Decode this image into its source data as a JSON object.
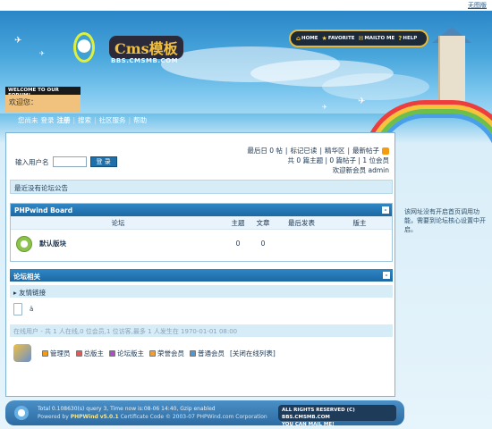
{
  "top_strip": {
    "link": "无图版"
  },
  "header": {
    "logo_text": "Cms模板",
    "logo_sub": "BBS.CMSMB.COM",
    "nav": [
      {
        "label": "HOME",
        "icon": "home-icon"
      },
      {
        "label": "FAVORITE",
        "icon": "star-icon"
      },
      {
        "label": "MAILTO ME",
        "icon": "mail-icon"
      },
      {
        "label": "HELP",
        "icon": "help-icon"
      }
    ],
    "welcome_bar": "WELCOME TO OUR FORUM!",
    "welcome_user": "欢迎您："
  },
  "menu": {
    "items": [
      "您尚未",
      "登录",
      "注册",
      "搜索",
      "社区服务",
      "帮助"
    ]
  },
  "login": {
    "label": "输入用户名",
    "button": "登 录"
  },
  "stats": {
    "line1_links": [
      "最后日 0 帖",
      "标记已读",
      "精华区",
      "最新帖子"
    ],
    "line2": "共 0 篇主题 | 0 篇帖子 | 1 位会员",
    "line3": "欢迎新会员 admin"
  },
  "notice": {
    "text": "最近没有论坛公告"
  },
  "board": {
    "title": "PHPwind Board",
    "collapse": "-",
    "headers": [
      "论坛",
      "主题",
      "文章",
      "最后发表",
      "版主"
    ],
    "rows": [
      {
        "name": "默认版块",
        "topics": "0",
        "posts": "0",
        "last": "",
        "mod": ""
      }
    ]
  },
  "related": {
    "title": "论坛相关",
    "collapse": "-",
    "links_label": "友情链接",
    "links_text": "ä",
    "online_title": "在线用户 - 共 1 人在线,0 位会员,1 位访客,最多 1 人发生在 1970-01-01 08:00",
    "legend": [
      {
        "label": "管理员",
        "color": "#f39c12"
      },
      {
        "label": "总版主",
        "color": "#e05a5a"
      },
      {
        "label": "论坛版主",
        "color": "#b04ad0"
      },
      {
        "label": "荣誉会员",
        "color": "#f0a030"
      },
      {
        "label": "普通会员",
        "color": "#4a9ad8"
      },
      {
        "label": "[关闭在线列表]",
        "color": ""
      }
    ]
  },
  "side_note": "该网址没有开启首页调用功能，需要到论坛核心设置中开启。",
  "footer": {
    "line1": "Total 0.108630(s) query 3, Time now is:08-06 14:40, Gzip enabled",
    "line2_pre": "Powered by",
    "line2_brand": "PHPWind",
    "line2_ver": "v5.0.1",
    "line2_post": "Certificate Code © 2003-07 PHPWind.com Corporation",
    "right_line1": "ALL RIGHTS RESERVED (C) BBS.CMSMB.COM",
    "right_line2": "YOU CAN MAIL ME!"
  }
}
